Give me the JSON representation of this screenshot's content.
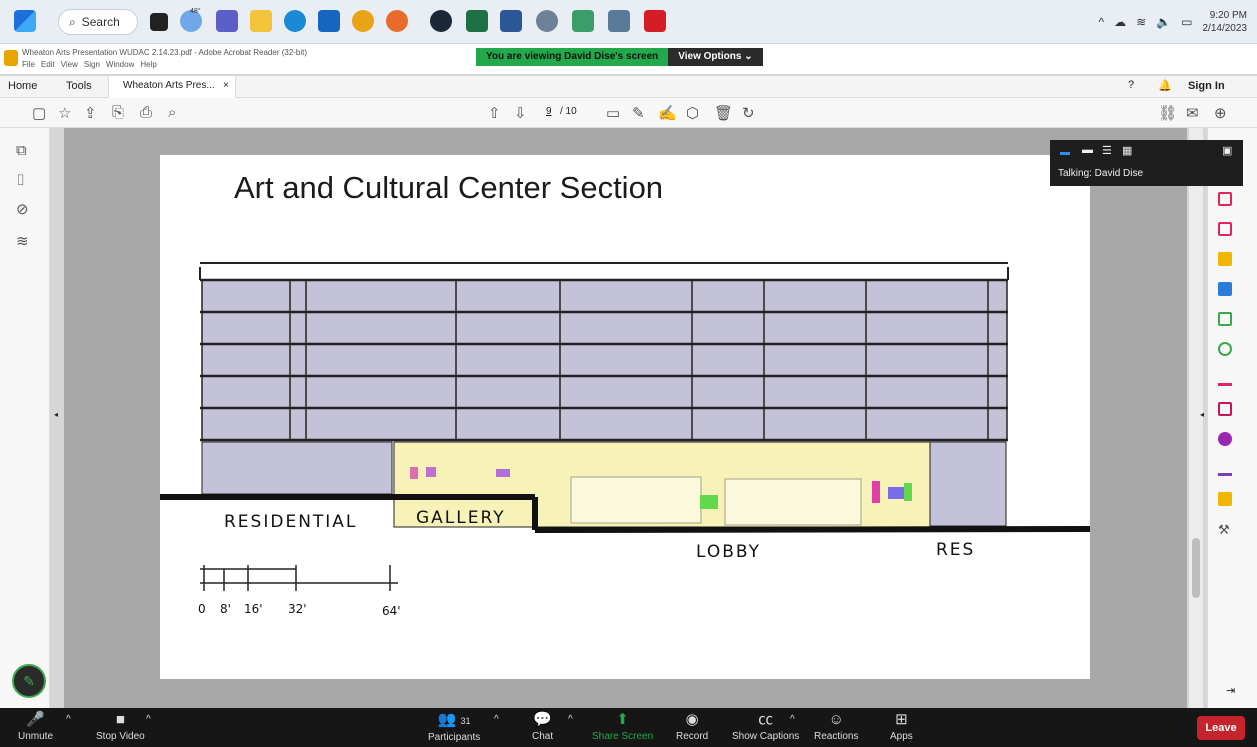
{
  "taskbar": {
    "search_label": "Search",
    "weather_temp": "48°",
    "time": "9:20 PM",
    "date": "2/14/2023"
  },
  "acrobat": {
    "window_title": "Wheaton Arts Presentation WUDAC 2.14.23.pdf - Adobe Acrobat Reader (32-bit)",
    "menu": [
      "File",
      "Edit",
      "View",
      "Sign",
      "Window",
      "Help"
    ],
    "home_tab": "Home",
    "tools_tab": "Tools",
    "doc_tab": "Wheaton Arts Pres...",
    "doc_tab_close": "×",
    "sign_in": "Sign In",
    "page_current": "9",
    "page_total": "/ 10"
  },
  "share": {
    "banner_text": "You are viewing David Dise's screen",
    "view_options": "View Options"
  },
  "talking": {
    "label": "Talking: David Dise"
  },
  "slide": {
    "title": "Art and Cultural Center Section",
    "labels": {
      "residential": "RESIDENTIAL",
      "gallery": "GALLERY",
      "lobby": "LOBBY",
      "res": "RES"
    },
    "scale_ticks": [
      "0",
      "8'",
      "16'",
      "32'",
      "64'"
    ]
  },
  "zoom": {
    "unmute": "Unmute",
    "stop_video": "Stop Video",
    "participants": "Participants",
    "participant_count": "31",
    "chat": "Chat",
    "share_screen": "Share Screen",
    "record": "Record",
    "show_captions": "Show Captions",
    "reactions": "Reactions",
    "apps": "Apps",
    "leave": "Leave"
  },
  "colors": {
    "accent_green": "#23a94b",
    "leave_red": "#c4252c",
    "floor_lavender": "#c4c2d8",
    "lobby_yellow": "#f7f2b8"
  }
}
